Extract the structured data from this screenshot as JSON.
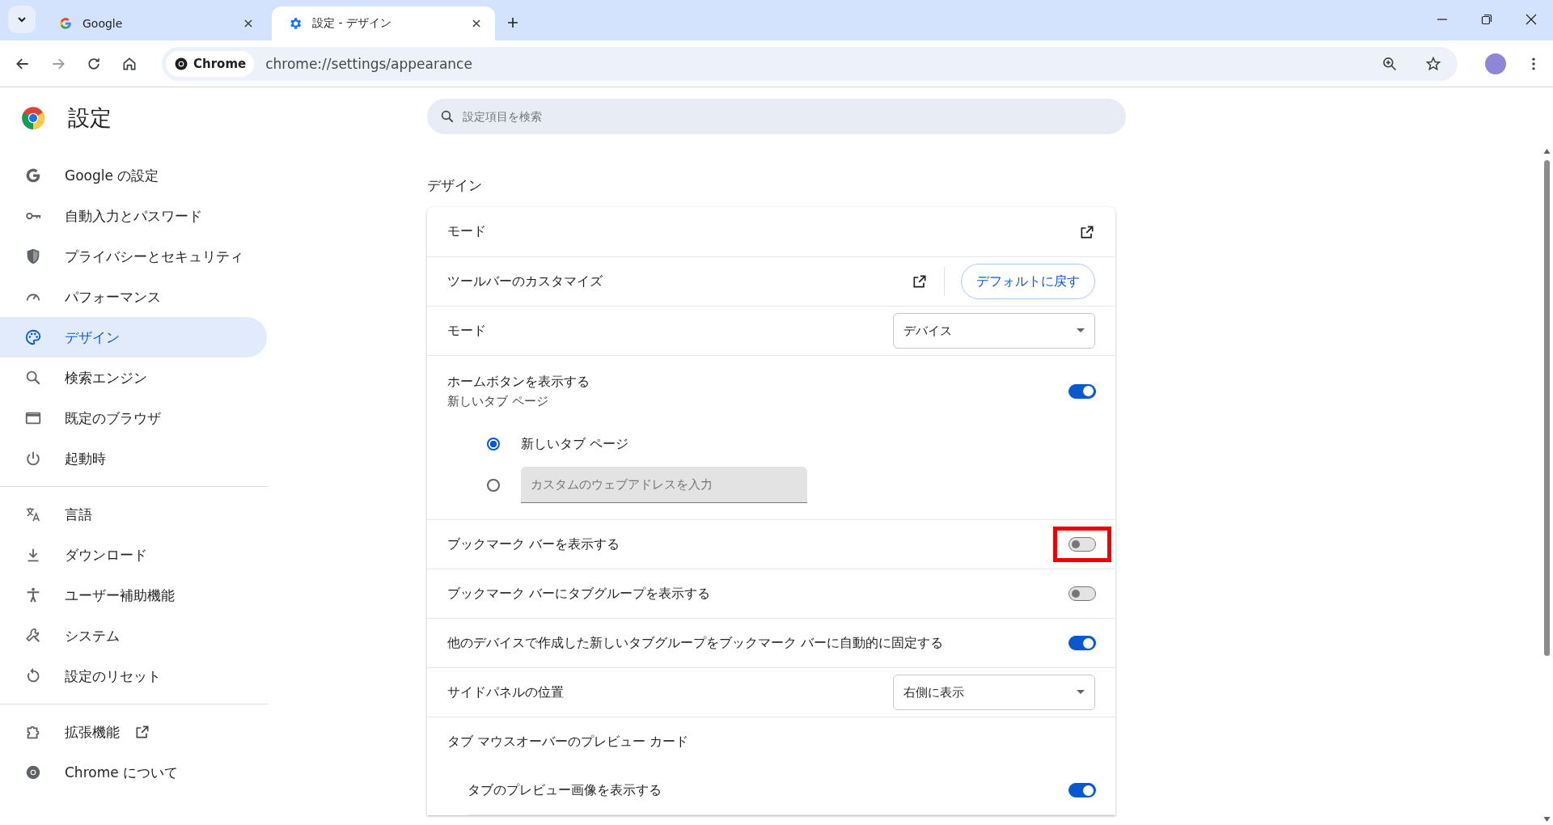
{
  "browser": {
    "tabs": [
      {
        "title": "Google",
        "selected": false
      },
      {
        "title": "設定 - デザイン",
        "selected": true
      }
    ],
    "address": {
      "chip": "Chrome",
      "url": "chrome://settings/appearance"
    }
  },
  "sidebar": {
    "title": "設定",
    "groups": [
      [
        {
          "label": "Google の設定",
          "selected": false,
          "external": false
        },
        {
          "label": "自動入力とパスワード",
          "selected": false,
          "external": false
        },
        {
          "label": "プライバシーとセキュリティ",
          "selected": false,
          "external": false
        },
        {
          "label": "パフォーマンス",
          "selected": false,
          "external": false
        },
        {
          "label": "デザイン",
          "selected": true,
          "external": false
        },
        {
          "label": "検索エンジン",
          "selected": false,
          "external": false
        },
        {
          "label": "既定のブラウザ",
          "selected": false,
          "external": false
        },
        {
          "label": "起動時",
          "selected": false,
          "external": false
        }
      ],
      [
        {
          "label": "言語",
          "selected": false,
          "external": false
        },
        {
          "label": "ダウンロード",
          "selected": false,
          "external": false
        },
        {
          "label": "ユーザー補助機能",
          "selected": false,
          "external": false
        },
        {
          "label": "システム",
          "selected": false,
          "external": false
        },
        {
          "label": "設定のリセット",
          "selected": false,
          "external": false
        }
      ],
      [
        {
          "label": "拡張機能",
          "selected": false,
          "external": true
        },
        {
          "label": "Chrome について",
          "selected": false
        }
      ]
    ]
  },
  "search": {
    "placeholder": "設定項目を検索"
  },
  "section": {
    "title": "デザイン",
    "rows": [
      {
        "kind": "link",
        "label": "モード"
      },
      {
        "kind": "link_button",
        "label": "ツールバーのカスタマイズ",
        "button": "デフォルトに戻す"
      },
      {
        "kind": "select",
        "label": "モード",
        "value": "デバイス"
      },
      {
        "kind": "toggle",
        "label": "ホームボタンを表示する",
        "sublabel": "新しいタブ ページ",
        "on": true
      },
      {
        "kind": "radios",
        "options": [
          {
            "kind": "text",
            "label": "新しいタブ ページ",
            "selected": true
          },
          {
            "kind": "input",
            "placeholder": "カスタムのウェブアドレスを入力",
            "selected": false
          }
        ]
      },
      {
        "kind": "toggle",
        "label": "ブックマーク バーを表示する",
        "on": false,
        "highlighted": true
      },
      {
        "kind": "toggle",
        "label": "ブックマーク バーにタブグループを表示する",
        "on": false
      },
      {
        "kind": "toggle",
        "label": "他のデバイスで作成した新しいタブグループをブックマーク バーに自動的に固定する",
        "on": true
      },
      {
        "kind": "select",
        "label": "サイドパネルの位置",
        "value": "右側に表示"
      },
      {
        "kind": "header",
        "label": "タブ マウスオーバーのプレビュー カード"
      },
      {
        "kind": "subtoggle",
        "label": "タブのプレビュー画像を表示する",
        "on": true
      }
    ]
  }
}
